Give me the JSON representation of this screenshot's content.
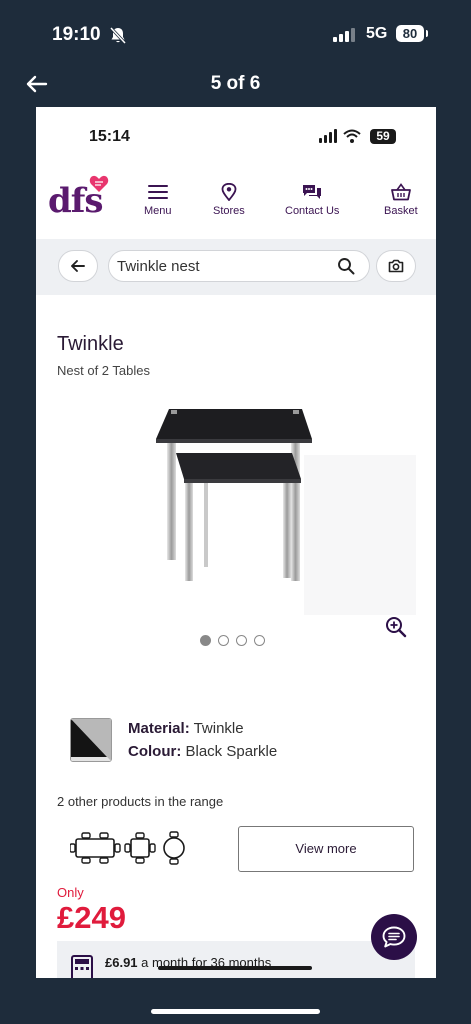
{
  "outer_status": {
    "time": "19:10",
    "network": "5G",
    "battery": "80"
  },
  "viewer": {
    "pager": "5 of 6"
  },
  "inner_status": {
    "time": "15:14",
    "battery": "59"
  },
  "header": {
    "logo": "dfs",
    "nav": [
      "Menu",
      "Stores",
      "Contact Us",
      "Basket"
    ]
  },
  "search": {
    "value": "Twinkle nest"
  },
  "product": {
    "title": "Twinkle",
    "subtitle": "Nest of 2 Tables",
    "image_dots": 4,
    "active_dot": 1,
    "material_label": "Material:",
    "material_value": " Twinkle",
    "colour_label": "Colour:",
    "colour_value": " Black Sparkle",
    "range_text": "2 other products in the range",
    "view_more": "View more",
    "only_label": "Only",
    "price": "£249",
    "finance_amount": "£6.91",
    "finance_text": " a month for 36 months"
  },
  "colors": {
    "brand_purple": "#5a1a6e",
    "price_red": "#e01b3c",
    "chat_bg": "#2b0f47",
    "outer_bg": "#1e2c3b"
  },
  "icons": [
    "bell-off-icon",
    "signal-icon",
    "back-arrow-icon",
    "wifi-icon",
    "menu-icon",
    "location-pin-icon",
    "chat-bubbles-icon",
    "basket-icon",
    "search-icon",
    "camera-icon",
    "zoom-in-icon",
    "calculator-icon",
    "chat-icon"
  ]
}
